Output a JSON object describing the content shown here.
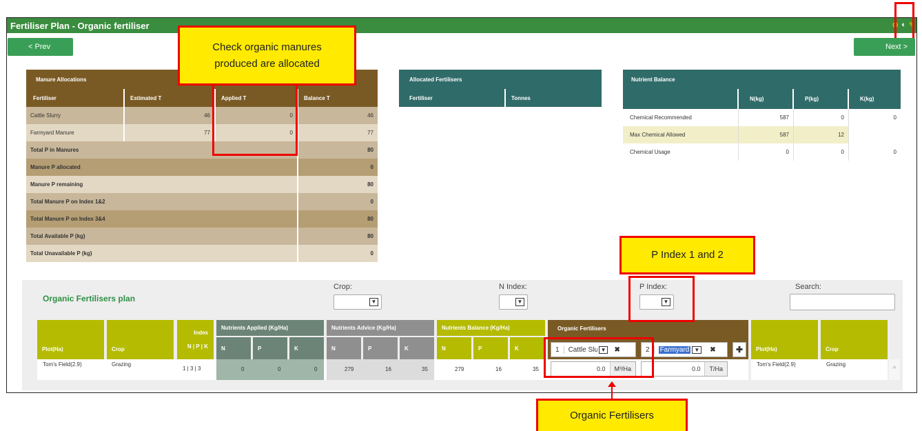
{
  "window": {
    "title": "Fertiliser Plan - Organic fertiliser"
  },
  "nav": {
    "prev": "< Prev",
    "next": "Next >"
  },
  "callouts": {
    "manures": "Check organic manures produced are allocated",
    "pindex": "P Index 1 and 2",
    "organic": "Organic Fertilisers"
  },
  "manure_allocations": {
    "title": "Manure Allocations",
    "columns": [
      "Fertiliser",
      "Estimated T",
      "Applied T",
      "Balance T"
    ],
    "rows": [
      {
        "name": "Cattle Slurry",
        "estimated": "46",
        "applied": "0",
        "balance": "46"
      },
      {
        "name": "Farmyard Manure",
        "estimated": "77",
        "applied": "0",
        "balance": "77"
      }
    ],
    "totals": [
      {
        "label": "Total P in Manures",
        "value": "80"
      },
      {
        "label": "Manure P allocated",
        "value": "0"
      },
      {
        "label": "Manure P remaining",
        "value": "80"
      },
      {
        "label": "Total Manure P on Index 1&2",
        "value": "0"
      },
      {
        "label": "Total Manure P on Index 3&4",
        "value": "80"
      },
      {
        "label": "Total Available P (kg)",
        "value": "80"
      },
      {
        "label": "Total Unavailable P (kg)",
        "value": "0"
      }
    ]
  },
  "allocated_fertilisers": {
    "title": "Allocated Fertilisers",
    "columns": [
      "Fertiliser",
      "Tonnes"
    ]
  },
  "nutrient_balance": {
    "title": "Nutrient Balance",
    "columns": [
      "",
      "N(kg)",
      "P(kg)",
      "K(kg)"
    ],
    "rows": [
      {
        "label": "Chemical Recommended",
        "n": "587",
        "p": "0",
        "k": "0"
      },
      {
        "label": "Max Chemical Allowed",
        "n": "587",
        "p": "12",
        "k": ""
      },
      {
        "label": "Chemical Usage",
        "n": "0",
        "p": "0",
        "k": "0"
      }
    ]
  },
  "plan": {
    "title": "Organic Fertilisers plan",
    "filters": {
      "crop": "Crop:",
      "nindex": "N Index:",
      "pindex": "P Index:",
      "search": "Search:"
    },
    "headers": {
      "plot": "Plot(Ha)",
      "crop": "Crop",
      "index": "Index",
      "index_sub": "N | P | K",
      "applied": "Nutrients Applied (Kg/Ha)",
      "advice": "Nutrients Advice (Kg/Ha)",
      "balance": "Nutrients Balance (Kg/Ha)",
      "organic": "Organic Fertilisers",
      "n": "N",
      "p": "P",
      "k": "K"
    },
    "organic_selectors": [
      {
        "num": "1",
        "name": "Cattle Slur",
        "value": "0.0",
        "unit": "M³/Ha"
      },
      {
        "num": "2",
        "name": "Farmyard",
        "value": "0.0",
        "unit": "T/Ha"
      }
    ],
    "row": {
      "plot": "Tom's Field(2.9)",
      "crop": "Grazing",
      "index": "1 | 3 | 3",
      "applied": [
        "0",
        "0",
        "0"
      ],
      "advice": [
        "279",
        "16",
        "35"
      ],
      "balance": [
        "279",
        "16",
        "35"
      ],
      "plot2": "Tom's Field(2.9)",
      "crop2": "Grazing"
    }
  }
}
